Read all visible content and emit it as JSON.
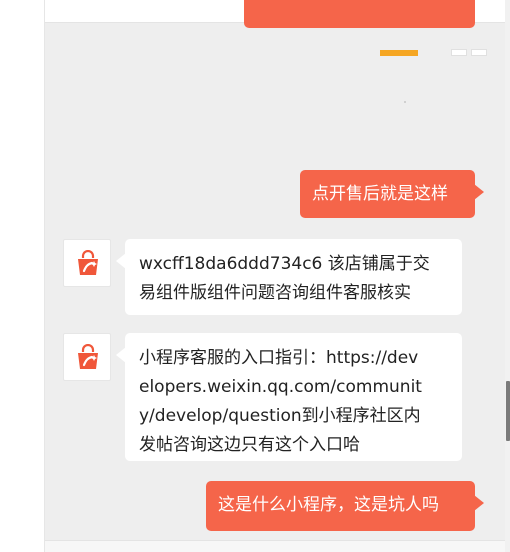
{
  "colors": {
    "outgoing_bubble": "#f5654a",
    "incoming_bubble": "#ffffff",
    "chat_background": "#eeeeee",
    "avatar_icon": "#f0573a"
  },
  "avatar_icon_name": "shopping-bag-sparkle-icon",
  "messages": [
    {
      "direction": "outgoing",
      "text": "点开售后就是这样"
    },
    {
      "direction": "incoming",
      "lines": [
        "wxcff18da6ddd734c6 该店铺属于交",
        "易组件版组件问题咨询组件客服核实"
      ]
    },
    {
      "direction": "incoming",
      "lines": [
        "小程序客服的入口指引：https://dev",
        "elopers.weixin.qq.com/communit",
        "y/develop/question到小程序社区内",
        "发帖咨询这边只有这个入口哈"
      ]
    },
    {
      "direction": "outgoing",
      "text": "这是什么小程序，这是坑人吗"
    }
  ]
}
